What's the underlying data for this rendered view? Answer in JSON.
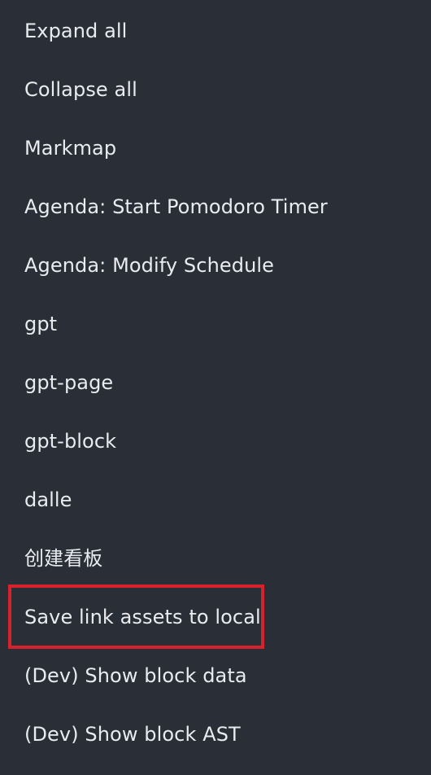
{
  "menu": {
    "items": [
      {
        "label": "Expand all"
      },
      {
        "label": "Collapse all"
      },
      {
        "label": "Markmap"
      },
      {
        "label": "Agenda: Start Pomodoro Timer"
      },
      {
        "label": "Agenda: Modify Schedule"
      },
      {
        "label": "gpt"
      },
      {
        "label": "gpt-page"
      },
      {
        "label": "gpt-block"
      },
      {
        "label": "dalle"
      },
      {
        "label": "创建看板"
      },
      {
        "label": "Save link assets to local"
      },
      {
        "label": "(Dev) Show block data"
      },
      {
        "label": "(Dev) Show block AST"
      }
    ]
  },
  "colors": {
    "background": "#2a2e37",
    "text": "#e9ebef",
    "highlight": "#d7212b"
  }
}
